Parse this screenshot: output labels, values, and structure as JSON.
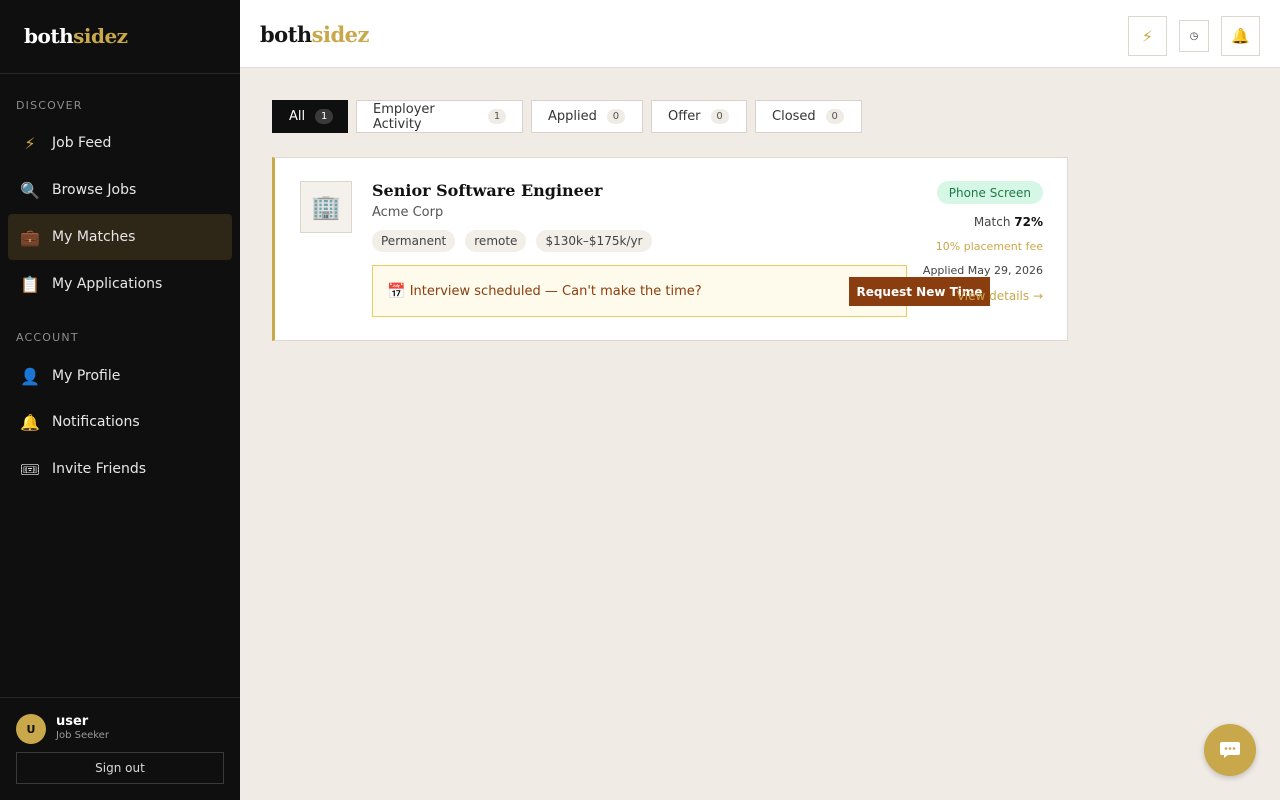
{
  "app": {
    "logo_part1": "both",
    "logo_part2": "sidez"
  },
  "sidebar": {
    "sections": [
      {
        "label": "DISCOVER"
      },
      {
        "label": "ACCOUNT"
      }
    ],
    "items": [
      {
        "label": "Job Feed",
        "icon": "⚡",
        "icon_name": "lightning-icon"
      },
      {
        "label": "Browse Jobs",
        "icon": "🔍",
        "icon_name": "magnifier-icon"
      },
      {
        "label": "My Matches",
        "icon": "💼",
        "icon_name": "briefcase-icon",
        "active": true
      },
      {
        "label": "My Applications",
        "icon": "📋",
        "icon_name": "clipboard-icon"
      },
      {
        "label": "My Profile",
        "icon": "👤",
        "icon_name": "person-icon"
      },
      {
        "label": "Notifications",
        "icon": "🔔",
        "icon_name": "bell-icon"
      },
      {
        "label": "Invite Friends",
        "icon": "🎟",
        "icon_name": "ticket-icon"
      }
    ],
    "user": {
      "initial": "U",
      "name": "user",
      "role": "Job Seeker",
      "signout_label": "Sign out"
    }
  },
  "header": {
    "buttons": [
      {
        "icon_name": "lightning-icon",
        "glyph": "⚡"
      },
      {
        "icon_name": "clock-icon",
        "glyph": "◷"
      },
      {
        "icon_name": "bell-icon",
        "glyph": "🔔"
      }
    ]
  },
  "tabs": [
    {
      "label": "All",
      "count": "1",
      "active": true
    },
    {
      "label": "Employer Activity",
      "count": "1"
    },
    {
      "label": "Applied",
      "count": "0"
    },
    {
      "label": "Offer",
      "count": "0"
    },
    {
      "label": "Closed",
      "count": "0"
    }
  ],
  "matches": [
    {
      "company_icon": "🏢",
      "title": "Senior Software Engineer",
      "company": "Acme Corp",
      "tags": [
        "Permanent",
        "remote",
        "$130k–$175k/yr"
      ],
      "notice": {
        "icon": "📅",
        "text": "Interview scheduled — Can't make the time?",
        "button_label": "Request New Time"
      },
      "status": "Phone Screen",
      "match_label": "Match",
      "match_value": "72%",
      "fee": "10% placement fee",
      "applied": "Applied May 29, 2026",
      "view_details": "View details →"
    }
  ],
  "colors": {
    "accent": "#c9a84c",
    "sidebar_bg": "#0f0f0f",
    "notice_text": "#8a3d0e",
    "status_green": "#1e7a4a"
  }
}
